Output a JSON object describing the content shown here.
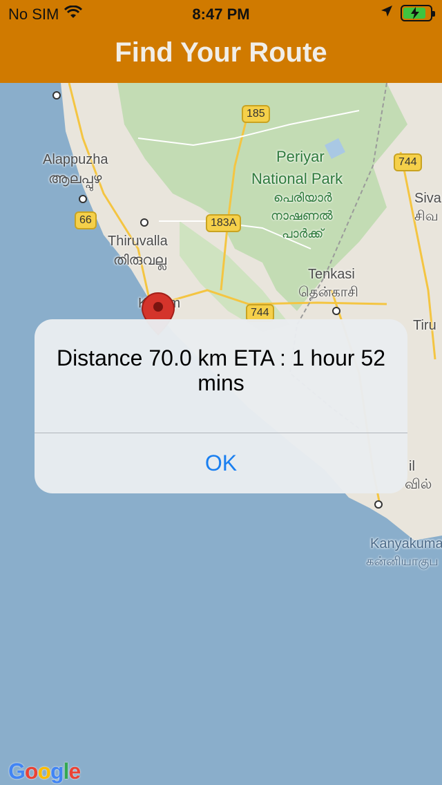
{
  "status_bar": {
    "carrier": "No SIM",
    "time": "8:47 PM"
  },
  "nav": {
    "title": "Find Your Route"
  },
  "map": {
    "places": {
      "alappuzha": "Alappuzha",
      "alappuzha_ml": "ആലപ്പുഴ",
      "thiruvalla": "Thiruvalla",
      "thiruvalla_ta": "തിരുവല്ല",
      "kollam": "Kollam",
      "periyar_1": "Periyar",
      "periyar_2": "National Park",
      "periyar_ml_1": "പെരിയാർ",
      "periyar_ml_2": "നാഷണൽ",
      "periyar_ml_3": "പാർക്ക്",
      "tenkasi": "Tenkasi",
      "tenkasi_ta": "தென்காசி",
      "sivakasi": "Siva",
      "sivakasi_ta": "சிவ",
      "tiru": "Tiru",
      "nagercoil_ta": "வில்",
      "nagercoil": "il",
      "kanyakumari": "Kanyakuma",
      "kanyakumari_ta": "கன்னியாகுப"
    },
    "shields": {
      "r185": "185",
      "r744a": "744",
      "r66": "66",
      "r183a": "183A",
      "r744b": "744"
    },
    "attribution": "Google"
  },
  "alert": {
    "message": "Distance 70.0 km ETA : 1 hour 52 mins",
    "ok_label": "OK"
  },
  "colors": {
    "accent": "#d07a00",
    "link_blue": "#1a7ff0",
    "sea": "#8aaecb",
    "land": "#e9e5dc",
    "forest": "#c3dcb4"
  }
}
